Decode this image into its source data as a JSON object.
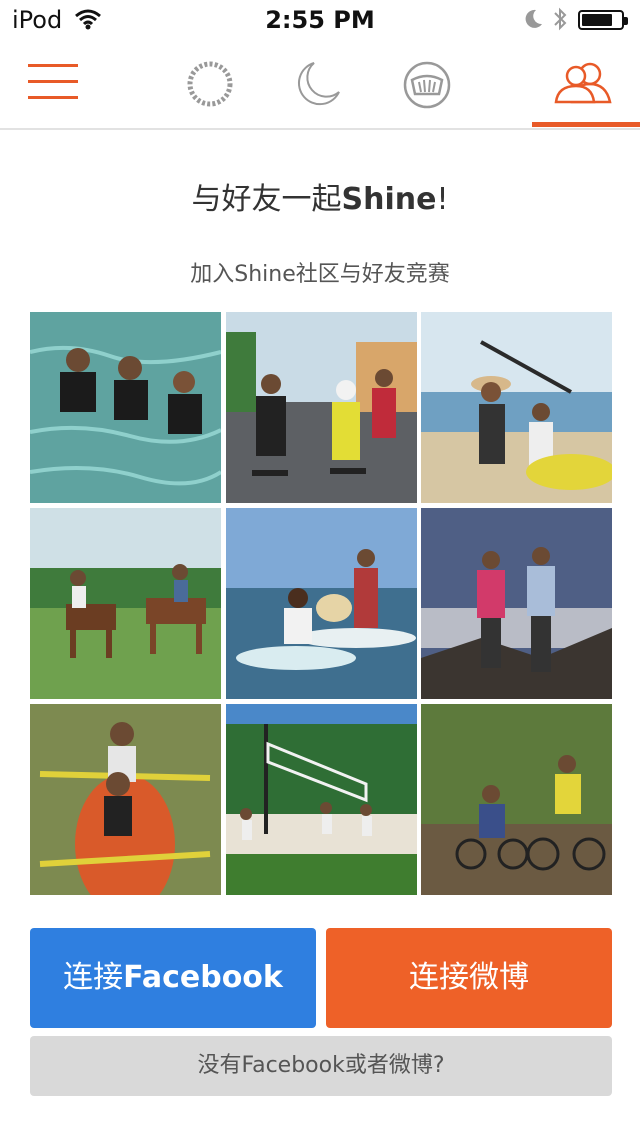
{
  "status_bar": {
    "carrier": "iPod",
    "time": "2:55 PM",
    "icons": [
      "wifi-icon",
      "moon-icon",
      "bluetooth-icon",
      "battery-icon"
    ]
  },
  "nav": {
    "items": [
      "menu-icon",
      "activity-ring-icon",
      "sleep-moon-icon",
      "dashboard-gauge-icon",
      "friends-icon"
    ],
    "active_item": "friends-icon",
    "accent_color": "#e85a28"
  },
  "headline": {
    "prefix": "与好友一起",
    "brand": "Shine",
    "suffix": "!"
  },
  "subtitle": "加入Shine社区与好友竞赛",
  "photos": [
    {
      "subject": "scuba divers in water"
    },
    {
      "subject": "skateboarders on street"
    },
    {
      "subject": "kayakers on beach"
    },
    {
      "subject": "horse riders on grass"
    },
    {
      "subject": "paddleboarders with dog"
    },
    {
      "subject": "hikers on mountain top"
    },
    {
      "subject": "kayaking couple"
    },
    {
      "subject": "beach volleyball"
    },
    {
      "subject": "mountain bikers"
    }
  ],
  "buttons": {
    "facebook_prefix": "连接",
    "facebook_brand": "Facebook",
    "weibo": "连接微博",
    "none": "没有Facebook或者微博?"
  },
  "colors": {
    "facebook_button": "#2f7fe0",
    "weibo_button": "#ee6128",
    "secondary_button": "#d9d9d9"
  }
}
